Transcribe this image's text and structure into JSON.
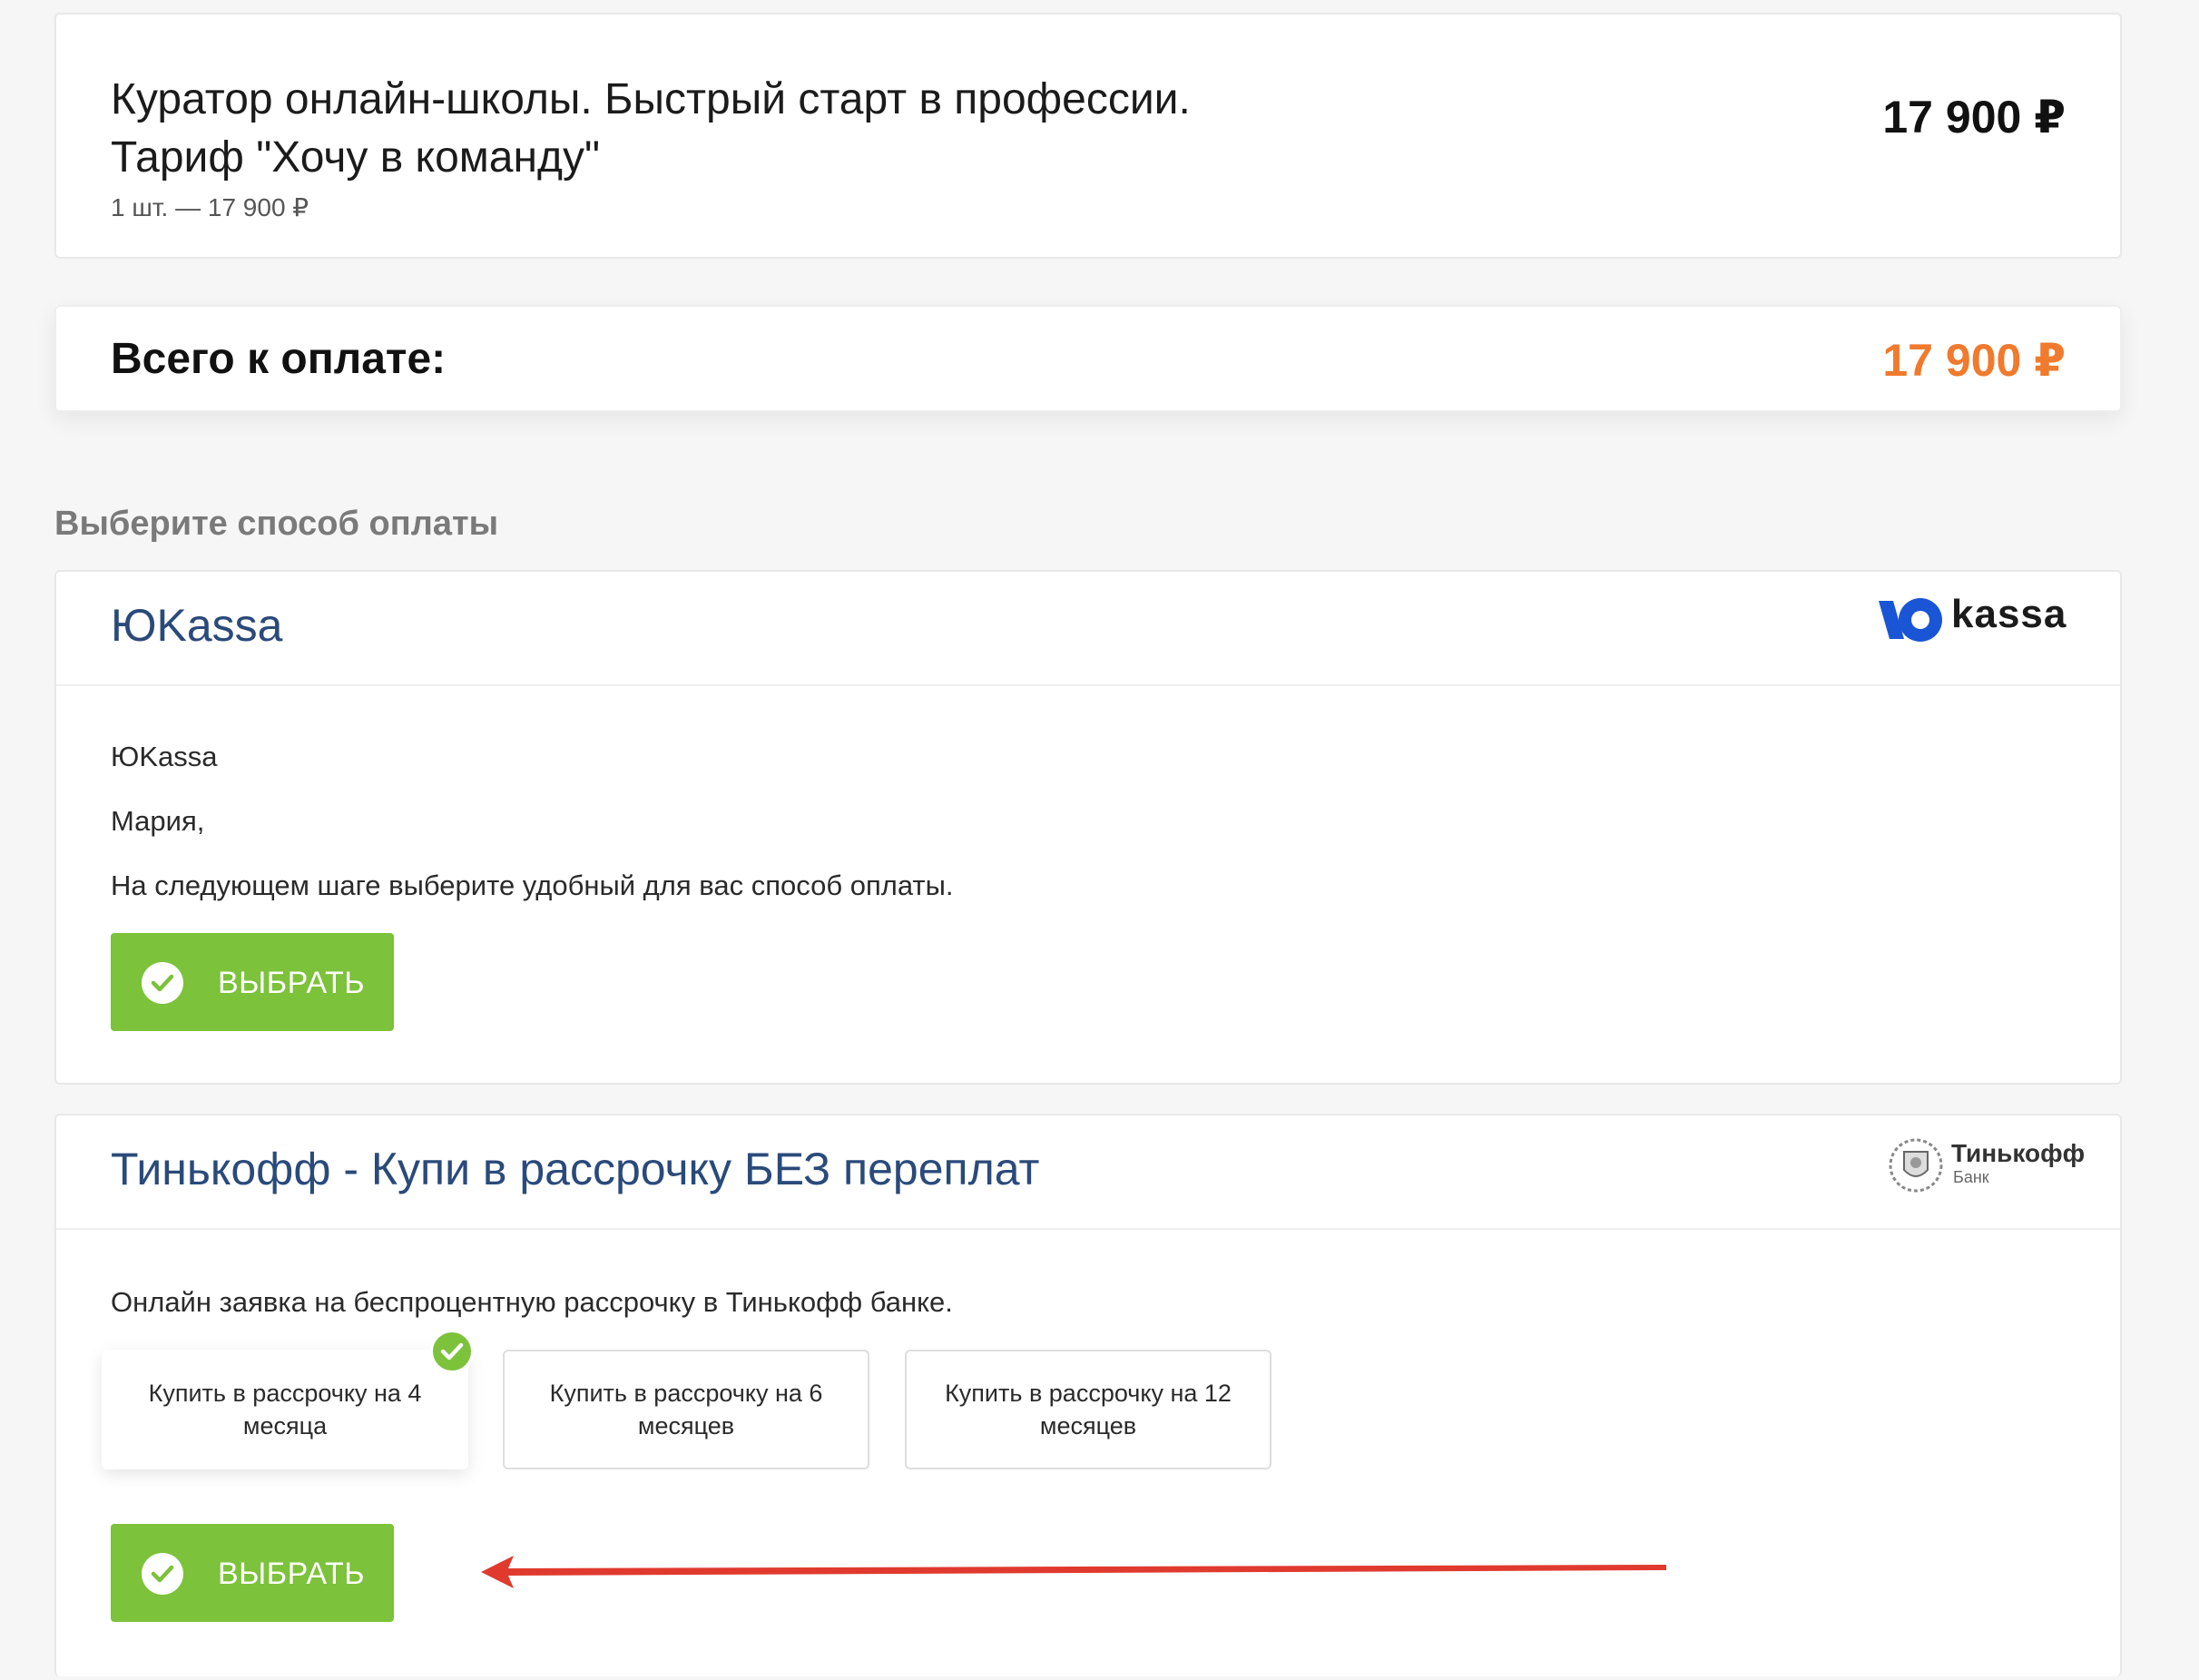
{
  "order": {
    "title_line1": "Куратор онлайн-школы. Быстрый старт в профессии.",
    "title_line2": "Тариф \"Хочу в команду\"",
    "quantity": "1 шт. — 17 900 ₽",
    "price": "17 900 ₽"
  },
  "total": {
    "label": "Всего к оплате:",
    "amount": "17 900 ₽"
  },
  "payment_section_title": "Выберите способ оплаты",
  "yukassa": {
    "title": "ЮKassa",
    "logo_text": "kassa",
    "line1": "ЮKassa",
    "line2": "Мария,",
    "line3": "На следующем шаге выберите удобный для вас способ оплаты.",
    "button_label": "ВЫБРАТЬ"
  },
  "tinkoff": {
    "title": "Тинькофф - Купи в рассрочку БЕЗ переплат",
    "logo_text": "Тинькофф",
    "logo_sub": "Банк",
    "description": "Онлайн заявка на беспроцентную рассрочку в Тинькофф банке.",
    "plans": [
      {
        "label": "Купить в рассрочку на 4 месяца",
        "selected": true
      },
      {
        "label": "Купить в рассрочку на 6 месяцев",
        "selected": false
      },
      {
        "label": "Купить в рассрочку на 12 месяцев",
        "selected": false
      }
    ],
    "button_label": "ВЫБРАТЬ"
  },
  "colors": {
    "accent_green": "#7cc23a",
    "total_orange": "#f07a2d",
    "title_blue": "#2a4a7a",
    "annotation_red": "#e03a2f"
  }
}
